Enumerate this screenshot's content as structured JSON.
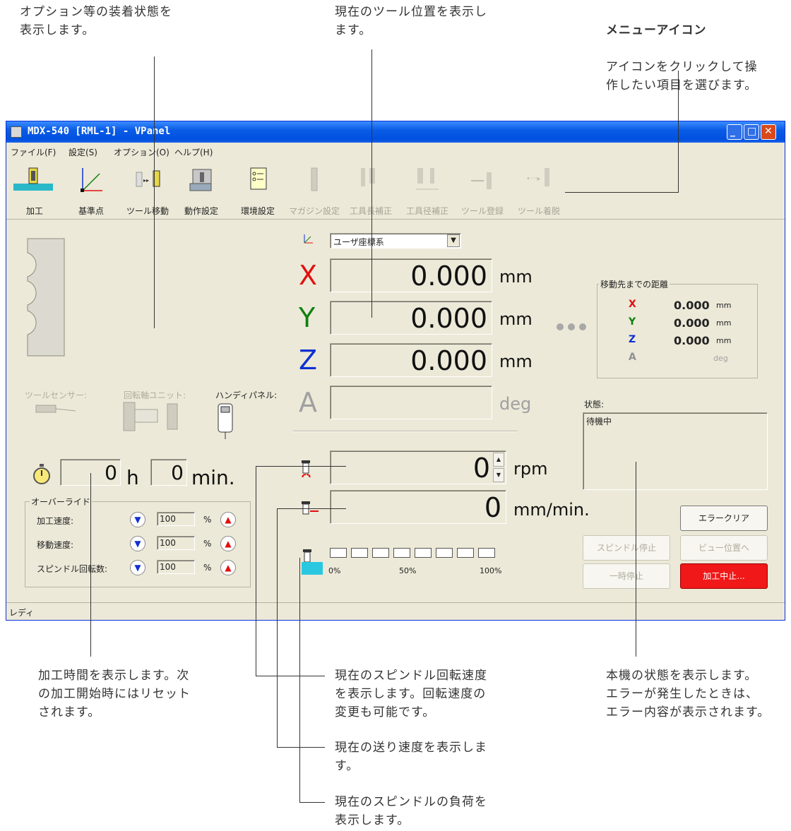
{
  "annotations": {
    "options": "オプション等の装着状態を\n表示します。",
    "tool_position": "現在のツール位置を表示し\nます。",
    "menu_icon_title": "メニューアイコン",
    "menu_icon_desc": "アイコンをクリックして操\n作したい項目を選びます。",
    "cut_time": "加工時間を表示します。次\nの加工開始時にはリセット\nされます。",
    "spindle_speed": "現在のスピンドル回転速度\nを表示します。回転速度の\n変更も可能です。",
    "feed_rate": "現在の送り速度を表示しま\nす。",
    "spindle_load": "現在のスピンドルの負荷を\n表示します。",
    "machine_status": "本機の状態を表示します。\nエラーが発生したときは、\nエラー内容が表示されます。"
  },
  "window": {
    "title": "MDX-540  [RML-1] - VPanel",
    "menu": [
      "ファイル(F)",
      "設定(S)",
      "オプション(O)",
      "ヘルプ(H)"
    ],
    "toolbar": [
      "加工",
      "基準点",
      "ツール移動",
      "動作設定",
      "環境設定",
      "マガジン設定",
      "工具長補正",
      "工具径補正",
      "ツール登録",
      "ツール着脱"
    ],
    "coord_system": "ユーザ座標系",
    "axes": [
      {
        "name": "X",
        "value": "0.000",
        "unit": "mm",
        "color": "#E01010"
      },
      {
        "name": "Y",
        "value": "0.000",
        "unit": "mm",
        "color": "#108010"
      },
      {
        "name": "Z",
        "value": "0.000",
        "unit": "mm",
        "color": "#1030D0"
      },
      {
        "name": "A",
        "value": "",
        "unit": "deg",
        "color": "#A0A0A0"
      }
    ],
    "distance": {
      "title": "移動先までの距離",
      "rows": [
        {
          "axis": "X",
          "value": "0.000",
          "unit": "mm"
        },
        {
          "axis": "Y",
          "value": "0.000",
          "unit": "mm"
        },
        {
          "axis": "Z",
          "value": "0.000",
          "unit": "mm"
        },
        {
          "axis": "A",
          "value": "",
          "unit": "deg"
        }
      ]
    },
    "options": {
      "tool_sensor": "ツールセンサー:",
      "rotary_unit": "回転軸ユニット:",
      "handy_panel": "ハンディパネル:"
    },
    "time": {
      "hours": "0",
      "h": "h",
      "minutes": "0",
      "min": "min."
    },
    "override": {
      "title": "オーバーライド",
      "rows": [
        {
          "label": "加工速度:",
          "value": "100",
          "unit": "%"
        },
        {
          "label": "移動速度:",
          "value": "100",
          "unit": "%"
        },
        {
          "label": "スピンドル回転数:",
          "value": "100",
          "unit": "%"
        }
      ]
    },
    "spindle": {
      "value": "0",
      "unit": "rpm"
    },
    "feed": {
      "value": "0",
      "unit": "mm/min."
    },
    "load": {
      "labels": [
        "0%",
        "50%",
        "100%"
      ],
      "level": 0
    },
    "status": {
      "label": "状態:",
      "text": "待機中"
    },
    "buttons": {
      "error_clear": "エラークリア",
      "spindle_stop": "スピンドル停止",
      "view_position": "ビュー位置へ",
      "pause": "一時停止",
      "abort": "加工中止..."
    },
    "statusbar": "レディ"
  }
}
